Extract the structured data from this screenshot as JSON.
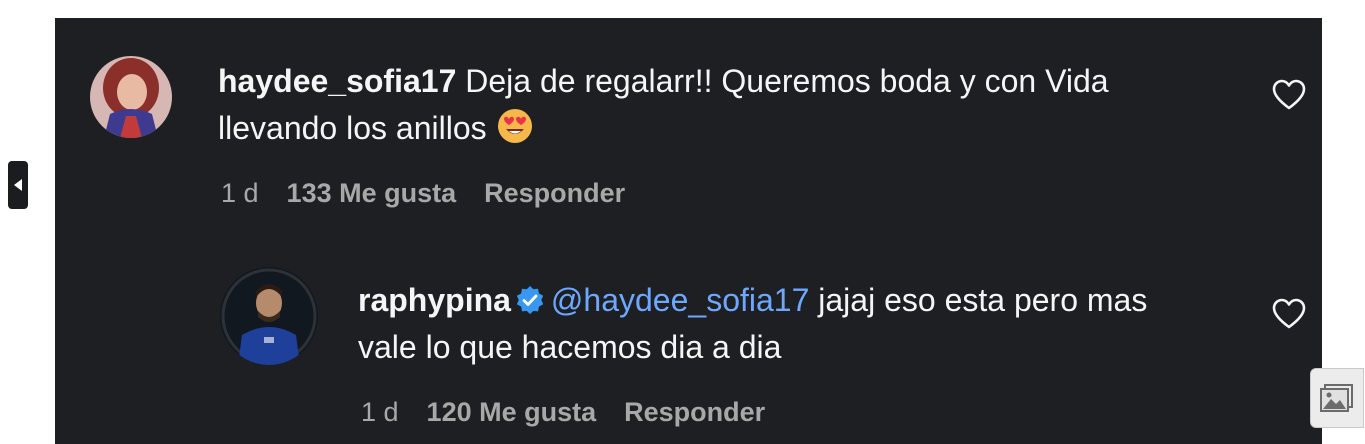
{
  "comments": [
    {
      "username": "haydee_sofia17",
      "text_line1": " Deja de regalarr!! Queremos boda y con Vida",
      "text_line2": "llevando los anillos ",
      "emoji": "smiling-face-with-heart-eyes",
      "time": "1 d",
      "likes": "133 Me gusta",
      "reply": "Responder"
    },
    {
      "username": "raphypina",
      "verified": true,
      "mention": "@haydee_sofia17",
      "text_line1": " jajaj eso esta pero mas",
      "text_line2": "vale lo que hacemos dia a dia",
      "time": "1 d",
      "likes": "120 Me gusta",
      "reply": "Responder"
    }
  ],
  "colors": {
    "background": "#1e1f22",
    "text": "#f5f5f5",
    "meta": "#a8a8a8",
    "mention": "#6ea8fe",
    "verified": "#3897f0"
  },
  "icons": {
    "like": "heart-outline-icon",
    "side": "caret-left-icon",
    "image": "image-icon"
  }
}
